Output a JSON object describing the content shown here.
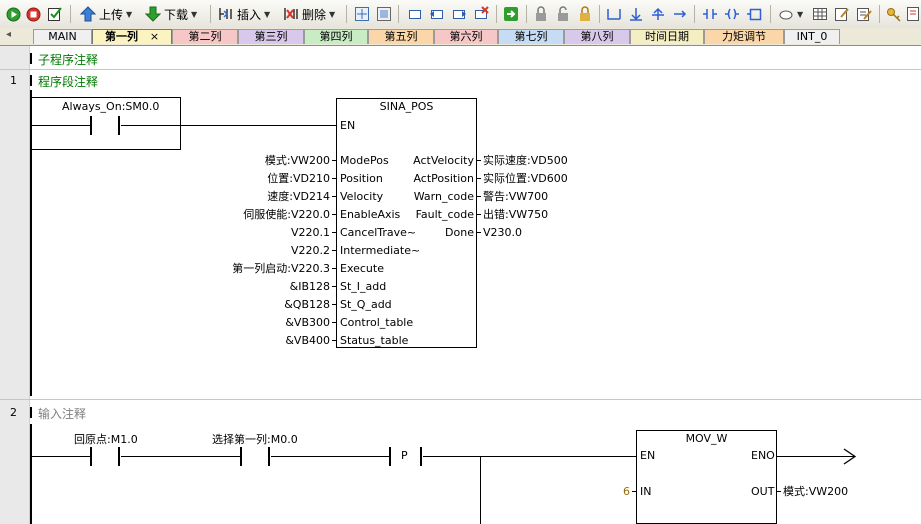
{
  "toolbar": {
    "upload_label": "上传",
    "download_label": "下载",
    "insert_label": "插入",
    "delete_label": "删除"
  },
  "tabs": [
    "MAIN",
    "第一列",
    "第二列",
    "第三列",
    "第四列",
    "第五列",
    "第六列",
    "第七列",
    "第八列",
    "时间日期",
    "力矩调节",
    "INT_0"
  ],
  "tab_close": "×",
  "subroutine_comment": "子程序注释",
  "networks": [
    {
      "number": "1",
      "comment": "程序段注释",
      "contact_label": "Always_On:SM0.0",
      "block": {
        "title": "SINA_POS",
        "en": "EN",
        "inputs": [
          {
            "param": "模式:VW200",
            "pin": "ModePos"
          },
          {
            "param": "位置:VD210",
            "pin": "Position"
          },
          {
            "param": "速度:VD214",
            "pin": "Velocity"
          },
          {
            "param": "伺服使能:V220.0",
            "pin": "EnableAxis"
          },
          {
            "param": "V220.1",
            "pin": "CancelTrave~"
          },
          {
            "param": "V220.2",
            "pin": "Intermediate~"
          },
          {
            "param": "第一列启动:V220.3",
            "pin": "Execute"
          },
          {
            "param": "&IB128",
            "pin": "St_I_add"
          },
          {
            "param": "&QB128",
            "pin": "St_Q_add"
          },
          {
            "param": "&VB300",
            "pin": "Control_table"
          },
          {
            "param": "&VB400",
            "pin": "Status_table"
          }
        ],
        "outputs": [
          {
            "pin": "ActVelocity",
            "param": "实际速度:VD500"
          },
          {
            "pin": "ActPosition",
            "param": "实际位置:VD600"
          },
          {
            "pin": "Warn_code",
            "param": "警告:VW700"
          },
          {
            "pin": "Fault_code",
            "param": "出错:VW750"
          },
          {
            "pin": "Done",
            "param": "V230.0"
          }
        ]
      }
    },
    {
      "number": "2",
      "comment": "输入注释",
      "contact1_label": "回原点:M1.0",
      "contact2_label": "选择第一列:M0.0",
      "p_label": "P",
      "block": {
        "title": "MOV_W",
        "en": "EN",
        "eno": "ENO",
        "in_pin": "IN",
        "out_pin": "OUT",
        "in_value": "6",
        "out_param": "模式:VW200"
      }
    }
  ],
  "colors": {
    "comment_green": "#007a00",
    "gray_comment": "#808080",
    "constant_orange": "#9a6a00"
  },
  "icons": [
    "run-icon",
    "stop-icon",
    "compile-icon",
    "upload-icon",
    "download-icon",
    "insert-icon",
    "delete-icon",
    "network-icon",
    "line-icon",
    "contact-icon",
    "coil-icon",
    "box-icon",
    "zoom-icon",
    "key-icon"
  ]
}
